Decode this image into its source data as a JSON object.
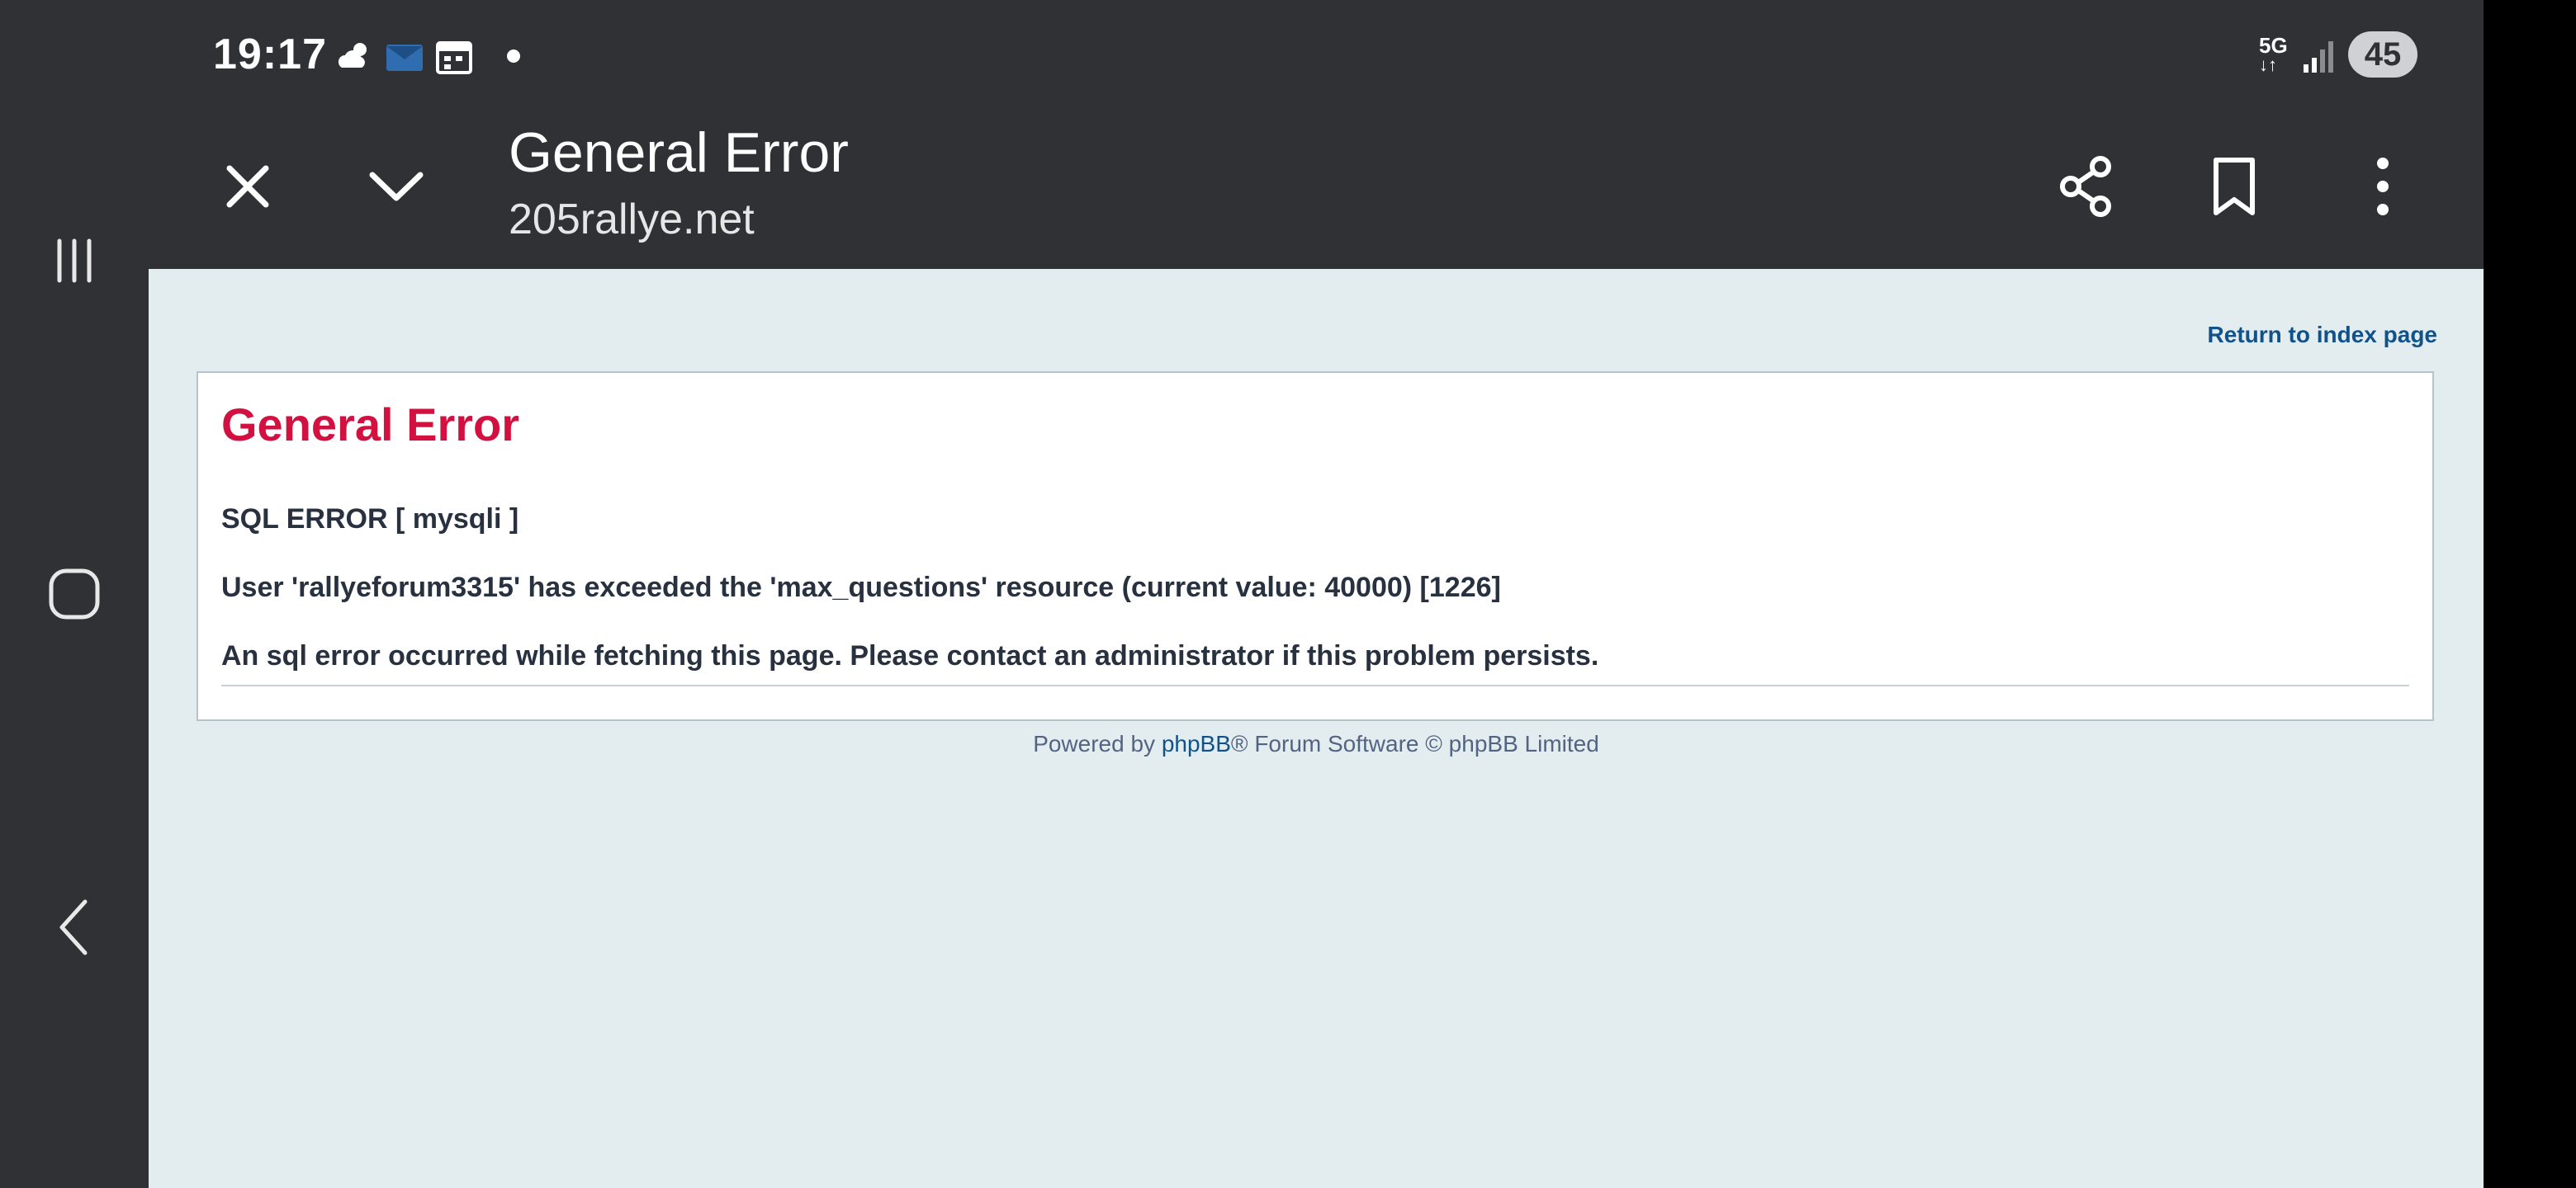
{
  "status_bar": {
    "time": "19:17",
    "icons": [
      "weather-icon",
      "mail-icon",
      "calendar-icon",
      "notification-dot-icon"
    ],
    "network_type": "5G",
    "signal_icon": "signal-icon",
    "battery": "45"
  },
  "toolbar": {
    "title": "General Error",
    "domain": "205rallye.net",
    "icons": [
      "close-icon",
      "chevron-down-icon",
      "share-icon",
      "bookmark-icon",
      "more-vert-icon"
    ]
  },
  "nav_bar": {
    "icons": [
      "recent-apps-icon",
      "home-icon",
      "back-icon"
    ]
  },
  "page": {
    "return_link": "Return to index page",
    "error_heading": "General Error",
    "sql_error": "SQL ERROR [ mysqli ]",
    "detail": "User 'rallyeforum3315' has exceeded the 'max_questions' resource (current value: 40000) [1226]",
    "message": "An sql error occurred while fetching this page. Please contact an administrator if this problem persists.",
    "footer_prefix": "Powered by ",
    "footer_link": "phpBB",
    "footer_suffix": "® Forum Software © phpBB Limited"
  },
  "colors": {
    "heading": "#d31141",
    "link": "#105289",
    "background": "#e3ecef",
    "chrome": "#303135"
  }
}
